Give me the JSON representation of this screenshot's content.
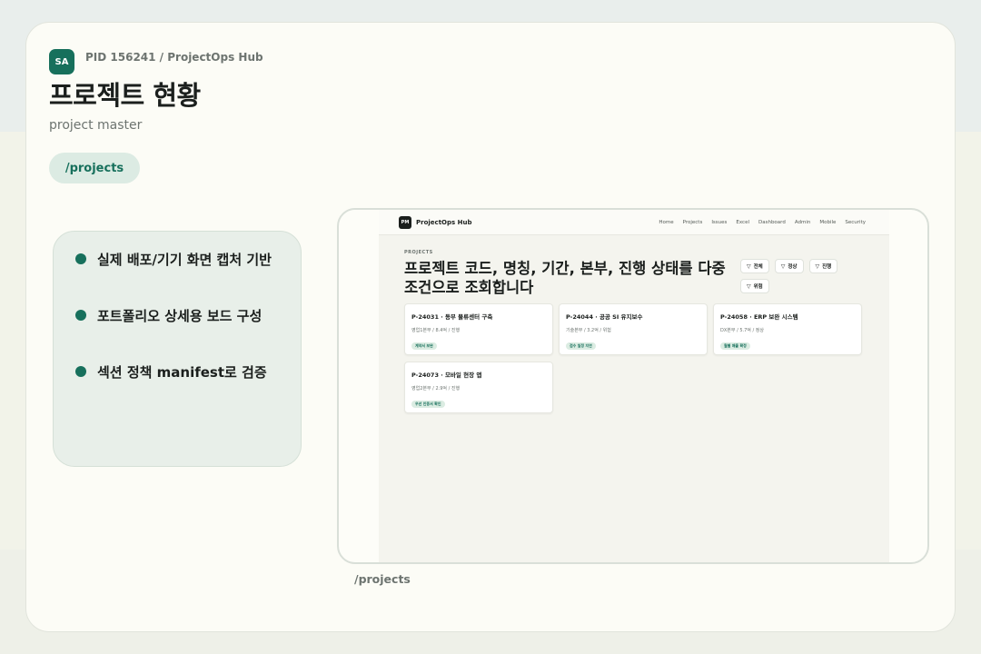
{
  "header": {
    "avatar": "SA",
    "pid": "PID 156241 / ProjectOps Hub",
    "title": "프로젝트 현황",
    "subtitle": "project master",
    "route": "/projects"
  },
  "notes": [
    "실제 배포/기기 화면 캡처 기반",
    "포트폴리오 상세용 보드 구성",
    "섹션 정책 manifest로 검증"
  ],
  "preview": {
    "logo": "PM",
    "brand": "ProjectOps Hub",
    "nav": [
      "Home",
      "Projects",
      "Issues",
      "Excel",
      "Dashboard",
      "Admin",
      "Mobile",
      "Security"
    ],
    "eyebrow": "PROJECTS",
    "headline": "프로젝트 코드, 명칭, 기간, 본부, 진행 상태를 다중 조건으로 조회합니다",
    "filters": [
      {
        "label": "전체",
        "icon": "filter-icon"
      },
      {
        "label": "정상",
        "icon": "filter-icon"
      },
      {
        "label": "진행",
        "icon": "filter-icon"
      },
      {
        "label": "위험",
        "icon": "filter-icon"
      }
    ],
    "projects": [
      {
        "title": "P-24031 · 동부 물류센터 구축",
        "meta": "영업1본부 / 8.4억 / 진행",
        "badge": "계약서 보완"
      },
      {
        "title": "P-24044 · 공공 SI 유지보수",
        "meta": "기술본부 / 3.2억 / 위험",
        "badge": "검수 일정 지연"
      },
      {
        "title": "P-24058 · ERP 보완 시스템",
        "meta": "DX본부 / 5.7억 / 정상",
        "badge": "월별 매출 확정"
      },
      {
        "title": "P-24073 · 모바일 현장 앱",
        "meta": "영업2본부 / 2.9억 / 진행",
        "badge": "우선 인증서 확인"
      }
    ],
    "caption": "/projects"
  },
  "colors": {
    "accent": "#17705c",
    "accent_soft": "#dcebe3",
    "text": "#1b1f1d",
    "muted": "#6d7470"
  }
}
